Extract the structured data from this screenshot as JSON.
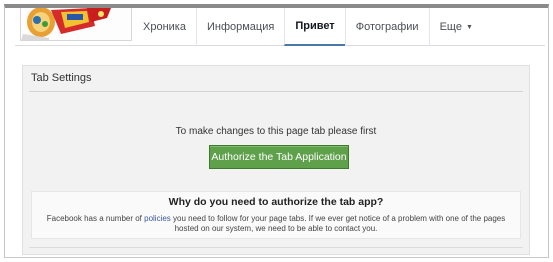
{
  "nav": {
    "tabs": [
      {
        "label": "Хроника"
      },
      {
        "label": "Информация"
      },
      {
        "label": "Привет"
      },
      {
        "label": "Фотографии"
      },
      {
        "label": "Еще"
      }
    ],
    "active_tab": "Привет"
  },
  "panel": {
    "title": "Tab Settings",
    "instruction": "To make changes to this page tab please first",
    "authorize_button": "Authorize the Tab Application",
    "why_title": "Why do you need to authorize the tab app?",
    "why_text_before": "Facebook has a number of ",
    "why_link": "policies",
    "why_text_after": " you need to follow for your page tabs. If we ever get notice of a problem with one of the pages hosted on our system, we need to be able to contact you."
  },
  "colors": {
    "button_green": "#5fa04b",
    "link_blue": "#3b5998",
    "panel_bg": "#f2f2f2"
  }
}
